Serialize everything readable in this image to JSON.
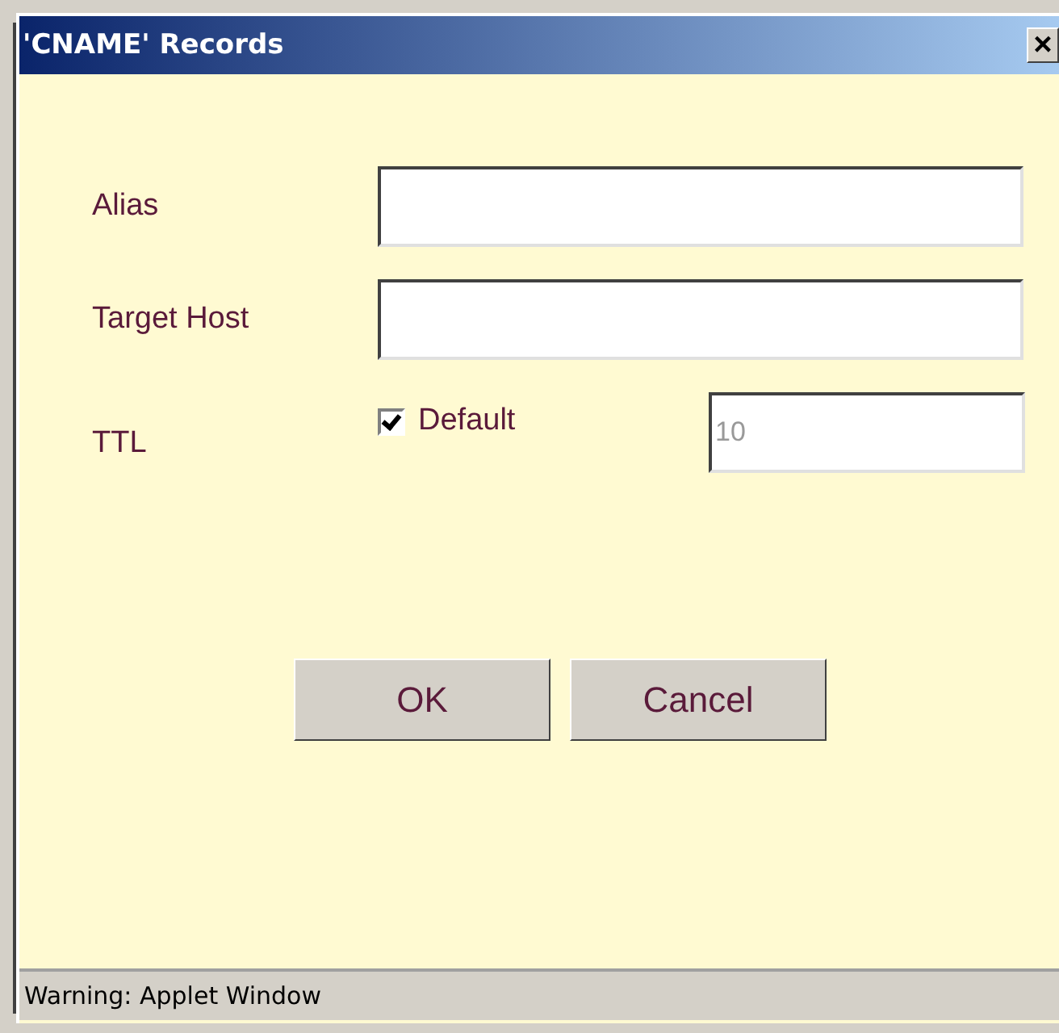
{
  "window": {
    "title": "'CNAME' Records",
    "close": "×"
  },
  "fields": [
    {
      "label": "Alias"
    },
    {
      "label": "Target Host"
    }
  ],
  "ttl": {
    "label": "TTL",
    "default_checkbox": {
      "label": "Default",
      "checked": true
    },
    "value": "10",
    "disabled": true
  },
  "buttons": [
    "OK",
    "Cancel"
  ],
  "status_bar": "Warning: Applet Window"
}
